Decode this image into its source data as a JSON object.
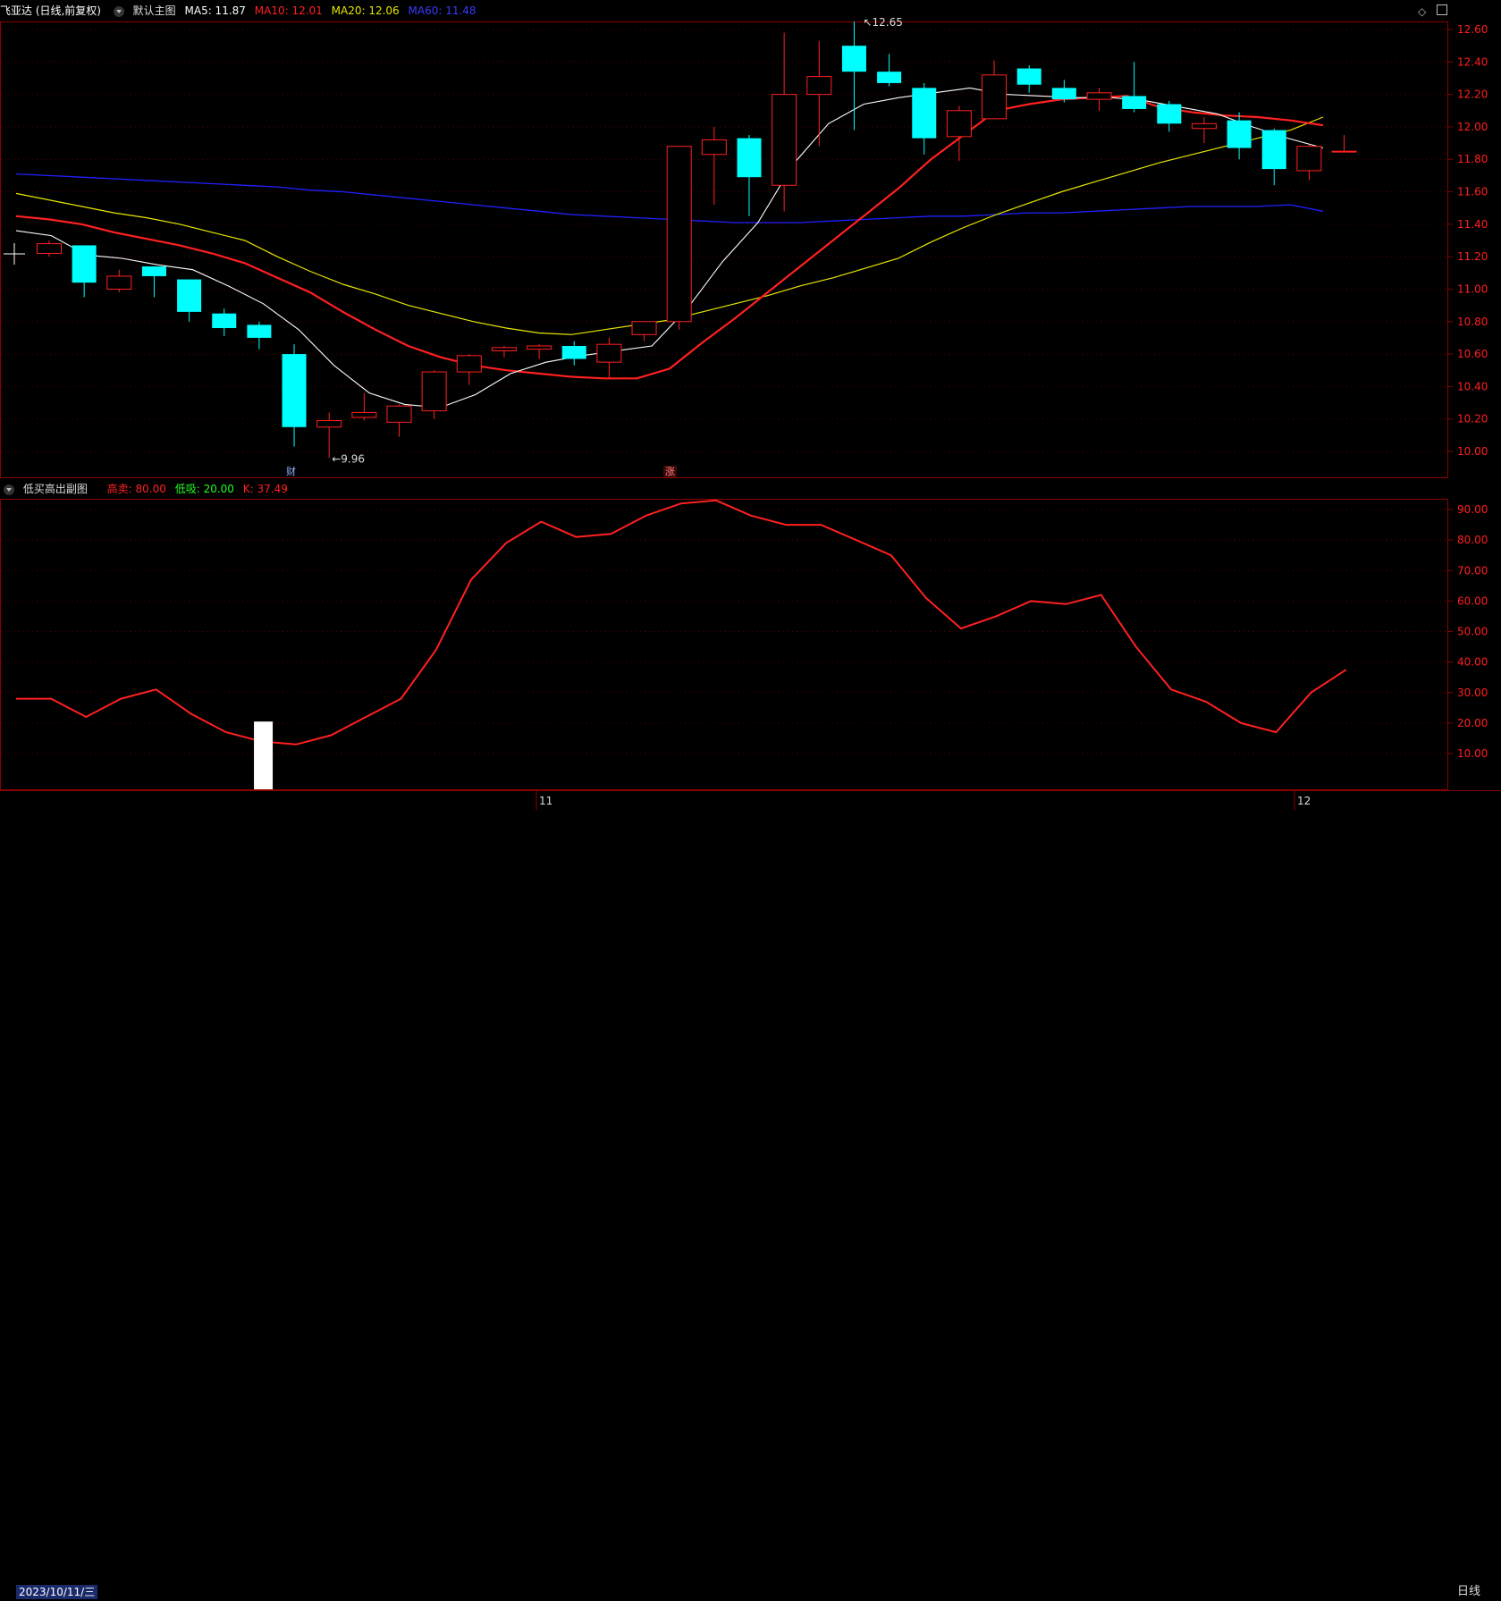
{
  "header": {
    "title": "飞亚达 (日线,前复权)",
    "main_chart_name": "默认主图",
    "ma5_label": "MA5: 11.87",
    "ma10_label": "MA10: 12.01",
    "ma20_label": "MA20: 12.06",
    "ma60_label": "MA60: 11.48",
    "colors": {
      "ma5": "#ffffff",
      "ma10": "#ff2020",
      "ma20": "#e6e600",
      "ma60": "#2020ff"
    }
  },
  "window_buttons": {
    "diamond": "◇",
    "square_icon": "restore-icon"
  },
  "sub_header": {
    "name": "低买高出副图",
    "high_label": "高卖: 80.00",
    "low_label": "低吸: 20.00",
    "k_label": "K: 37.49"
  },
  "markers": {
    "cai": "财",
    "zhang": "涨",
    "high_price": "12.65",
    "low_price": "9.96"
  },
  "axis": {
    "price_ticks": [
      "12.60",
      "12.40",
      "12.20",
      "12.00",
      "11.80",
      "11.60",
      "11.40",
      "11.20",
      "11.00",
      "10.80",
      "10.60",
      "10.40",
      "10.20",
      "10.00"
    ],
    "osc_ticks": [
      "90.00",
      "80.00",
      "70.00",
      "60.00",
      "50.00",
      "40.00",
      "30.00",
      "20.00",
      "10.00"
    ]
  },
  "footer": {
    "start_date": "2023/10/11/三",
    "month_nov": "11",
    "month_dec": "12",
    "period": "日线"
  },
  "chart_data": [
    {
      "type": "candlestick",
      "title": "飞亚达 (日线,前复权)",
      "ylim": [
        9.9,
        12.65
      ],
      "candles": [
        {
          "o": 11.22,
          "c": 11.28,
          "h": 11.3,
          "l": 11.2
        },
        {
          "o": 11.27,
          "c": 11.04,
          "h": 11.27,
          "l": 10.95
        },
        {
          "o": 11.0,
          "c": 11.08,
          "h": 11.12,
          "l": 10.98
        },
        {
          "o": 11.14,
          "c": 11.08,
          "h": 11.14,
          "l": 10.95
        },
        {
          "o": 11.06,
          "c": 10.86,
          "h": 11.06,
          "l": 10.8
        },
        {
          "o": 10.85,
          "c": 10.76,
          "h": 10.88,
          "l": 10.71
        },
        {
          "o": 10.78,
          "c": 10.7,
          "h": 10.8,
          "l": 10.63
        },
        {
          "o": 10.6,
          "c": 10.15,
          "h": 10.66,
          "l": 10.03
        },
        {
          "o": 10.15,
          "c": 10.19,
          "h": 10.24,
          "l": 9.96
        },
        {
          "o": 10.21,
          "c": 10.24,
          "h": 10.36,
          "l": 10.19
        },
        {
          "o": 10.18,
          "c": 10.28,
          "h": 10.29,
          "l": 10.09
        },
        {
          "o": 10.25,
          "c": 10.49,
          "h": 10.5,
          "l": 10.2
        },
        {
          "o": 10.49,
          "c": 10.59,
          "h": 10.6,
          "l": 10.41
        },
        {
          "o": 10.62,
          "c": 10.64,
          "h": 10.65,
          "l": 10.58
        },
        {
          "o": 10.63,
          "c": 10.65,
          "h": 10.66,
          "l": 10.57
        },
        {
          "o": 10.65,
          "c": 10.57,
          "h": 10.68,
          "l": 10.53
        },
        {
          "o": 10.55,
          "c": 10.66,
          "h": 10.7,
          "l": 10.45
        },
        {
          "o": 10.72,
          "c": 10.8,
          "h": 10.8,
          "l": 10.68
        },
        {
          "o": 10.8,
          "c": 11.88,
          "h": 11.88,
          "l": 10.75
        },
        {
          "o": 11.83,
          "c": 11.92,
          "h": 12.0,
          "l": 11.52
        },
        {
          "o": 11.93,
          "c": 11.69,
          "h": 11.95,
          "l": 11.45
        },
        {
          "o": 11.64,
          "c": 12.2,
          "h": 12.58,
          "l": 11.48
        },
        {
          "o": 12.2,
          "c": 12.31,
          "h": 12.53,
          "l": 11.88
        },
        {
          "o": 12.5,
          "c": 12.34,
          "h": 12.65,
          "l": 11.98
        },
        {
          "o": 12.34,
          "c": 12.27,
          "h": 12.45,
          "l": 12.25
        },
        {
          "o": 12.24,
          "c": 11.93,
          "h": 12.27,
          "l": 11.83
        },
        {
          "o": 11.94,
          "c": 12.1,
          "h": 12.13,
          "l": 11.79
        },
        {
          "o": 12.05,
          "c": 12.32,
          "h": 12.41,
          "l": 12.05
        },
        {
          "o": 12.36,
          "c": 12.26,
          "h": 12.38,
          "l": 12.21
        },
        {
          "o": 12.24,
          "c": 12.17,
          "h": 12.29,
          "l": 12.15
        },
        {
          "o": 12.17,
          "c": 12.21,
          "h": 12.24,
          "l": 12.1
        },
        {
          "o": 12.19,
          "c": 12.11,
          "h": 12.4,
          "l": 12.09
        },
        {
          "o": 12.14,
          "c": 12.02,
          "h": 12.16,
          "l": 11.97
        },
        {
          "o": 11.99,
          "c": 12.02,
          "h": 12.06,
          "l": 11.9
        },
        {
          "o": 12.04,
          "c": 11.87,
          "h": 12.09,
          "l": 11.8
        },
        {
          "o": 11.98,
          "c": 11.74,
          "h": 11.99,
          "l": 11.64
        },
        {
          "o": 11.73,
          "c": 11.88,
          "h": 11.89,
          "l": 11.67
        },
        {
          "o": 11.85,
          "c": 11.85,
          "h": 11.95,
          "l": 11.85
        }
      ],
      "series": [
        {
          "name": "MA5",
          "values": [
            11.36,
            11.33,
            11.21,
            11.19,
            11.15,
            11.12,
            11.02,
            10.91,
            10.75,
            10.53,
            10.36,
            10.29,
            10.27,
            10.35,
            10.48,
            10.55,
            10.59,
            10.62,
            10.65,
            10.88,
            11.17,
            11.41,
            11.77,
            12.02,
            12.14,
            12.18,
            12.21,
            12.24,
            12.2,
            12.19,
            12.18,
            12.18,
            12.16,
            12.12,
            12.08,
            12.0,
            11.93,
            11.87
          ]
        },
        {
          "name": "MA10",
          "values": [
            11.45,
            11.43,
            11.4,
            11.35,
            11.31,
            11.27,
            11.22,
            11.16,
            11.07,
            10.98,
            10.86,
            10.75,
            10.65,
            10.58,
            10.53,
            10.5,
            10.48,
            10.46,
            10.45,
            10.45,
            10.51,
            10.67,
            10.82,
            10.98,
            11.14,
            11.3,
            11.46,
            11.62,
            11.8,
            11.95,
            12.1,
            12.14,
            12.17,
            12.18,
            12.19,
            12.12,
            12.09,
            12.07,
            12.06,
            12.04,
            12.01
          ]
        },
        {
          "name": "MA20",
          "values": [
            11.59,
            11.55,
            11.51,
            11.47,
            11.44,
            11.4,
            11.35,
            11.3,
            11.2,
            11.11,
            11.03,
            10.97,
            10.9,
            10.85,
            10.8,
            10.76,
            10.73,
            10.72,
            10.75,
            10.78,
            10.81,
            10.86,
            10.91,
            10.96,
            11.02,
            11.07,
            11.13,
            11.19,
            11.29,
            11.38,
            11.46,
            11.53,
            11.6,
            11.66,
            11.72,
            11.78,
            11.83,
            11.88,
            11.93,
            11.98,
            12.06
          ]
        },
        {
          "name": "MA60",
          "values": [
            11.71,
            11.7,
            11.69,
            11.68,
            11.67,
            11.66,
            11.65,
            11.64,
            11.63,
            11.61,
            11.6,
            11.58,
            11.56,
            11.54,
            11.52,
            11.5,
            11.48,
            11.46,
            11.45,
            11.44,
            11.43,
            11.42,
            11.41,
            11.41,
            11.41,
            11.42,
            11.43,
            11.44,
            11.45,
            11.45,
            11.46,
            11.47,
            11.47,
            11.48,
            11.49,
            11.5,
            11.51,
            11.51,
            11.51,
            11.52,
            11.48
          ]
        }
      ]
    },
    {
      "type": "line",
      "title": "低买高出副图",
      "ylim": [
        0,
        100
      ],
      "series": [
        {
          "name": "K",
          "values": [
            28,
            28,
            22,
            28,
            31,
            23,
            17,
            14,
            13,
            16,
            22,
            28,
            44,
            67,
            79,
            86,
            81,
            82,
            88,
            92,
            93,
            88,
            85,
            85,
            80,
            75,
            61,
            51,
            55,
            60,
            59,
            62,
            45,
            31,
            27,
            20,
            17,
            30,
            37.49
          ]
        }
      ],
      "bar_at_index": 7
    }
  ]
}
